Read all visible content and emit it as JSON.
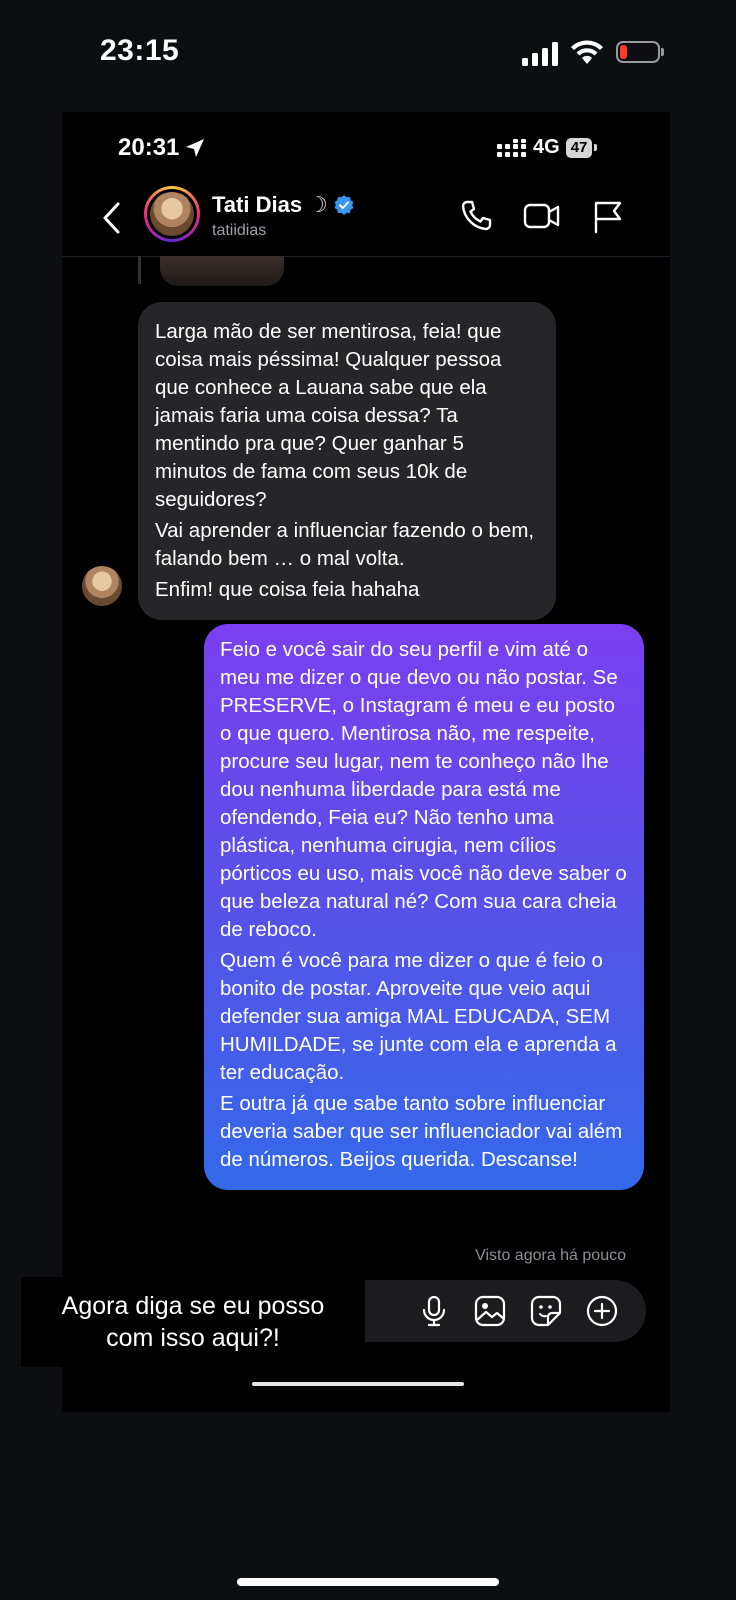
{
  "outer_status": {
    "time": "23:15",
    "battery_color": "#ff3b30"
  },
  "inner_status": {
    "time": "20:31",
    "network": "4G",
    "battery": "47"
  },
  "header": {
    "name": "Tati Dias",
    "moon": "☽",
    "username": "tatiidias",
    "icons": [
      "back-chevron-icon",
      "phone-icon",
      "video-icon",
      "flag-icon"
    ],
    "verified_color": "#3897f0"
  },
  "messages": {
    "incoming": [
      "Larga mão de ser mentirosa, feia! que coisa mais péssima! Qualquer pessoa que conhece a Lauana sabe que ela jamais faria uma coisa dessa? Ta mentindo pra que? Quer ganhar 5 minutos de fama com seus 10k de seguidores?",
      "Vai aprender a influenciar fazendo o bem, falando bem … o mal volta.",
      "Enfim! que coisa feia hahaha"
    ],
    "outgoing": [
      "Feio e você sair do seu perfil e vim até o meu me dizer o que devo ou não postar. Se PRESERVE, o Instagram é meu e eu posto o que quero. Mentirosa não, me respeite, procure seu lugar, nem te conheço não lhe dou nenhuma liberdade para está me ofendendo, Feia eu? Não tenho uma plástica, nenhuma cirugia, nem cílios pórticos eu uso, mais você não deve saber o que beleza natural né? Com sua cara cheia de reboco.",
      "Quem é você para me dizer o que é feio o bonito de postar. Aproveite que veio aqui defender sua amiga MAL EDUCADA, SEM HUMILDADE, se junte com ela e aprenda a ter educação.",
      "E outra já que sabe tanto sobre influenciar deveria saber que ser influenciador vai além de números. Beijos querida. Descanse!"
    ],
    "seen": "Visto agora há pouco",
    "outgoing_gradient": [
      "#7a3ff0",
      "#3469ea"
    ]
  },
  "composer": {
    "icons": [
      "microphone-icon",
      "gallery-icon",
      "sticker-icon",
      "plus-icon"
    ]
  },
  "caption": {
    "line1": "Agora diga se eu posso",
    "line2": "com isso aqui?!"
  }
}
